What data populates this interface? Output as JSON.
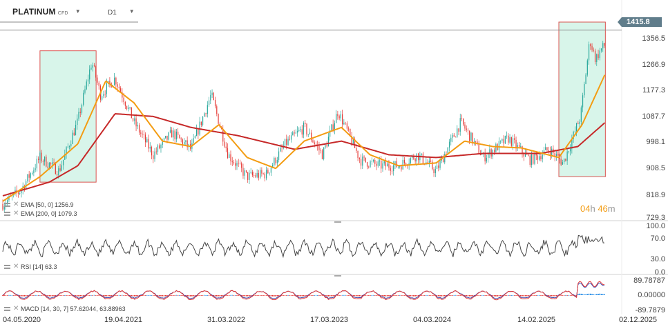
{
  "toolbar": {
    "symbol": "PLATINUM",
    "symbol_tag": "CFD",
    "interval": "D1"
  },
  "price_axis": {
    "labels": [
      "1356.5",
      "1266.9",
      "1177.3",
      "1087.7",
      "998.1",
      "908.5",
      "818.9",
      "729.3"
    ]
  },
  "current_price": "1415.8",
  "countdown": {
    "hours": "04",
    "h": "h",
    "minutes": "46",
    "m": "m"
  },
  "indicators": {
    "ema50": "EMA [50, 0] 1256.9",
    "ema200": "EMA [200, 0] 1079.3",
    "rsi": "RSI [14] 63.3",
    "macd": "MACD [14, 30, 7] 57.62044, 63.88963"
  },
  "rsi_axis": {
    "labels": [
      "100.0",
      "70.0",
      "30.0",
      "0.0"
    ]
  },
  "macd_axis": {
    "labels": [
      "89.78787",
      "0.00000",
      "-89.7879"
    ]
  },
  "dates": [
    "04.05.2020",
    "19.04.2021",
    "31.03.2022",
    "17.03.2023",
    "04.03.2024",
    "14.02.2025",
    "02.12.2025"
  ],
  "colors": {
    "up": "#26a69a",
    "down": "#e53935",
    "ema50": "#f39c12",
    "ema200": "#c62828",
    "highlight_fill": "#d8f5ea",
    "highlight_border": "#d9534f",
    "rsi": "#444444",
    "macd_line": "#e53935",
    "signal_line": "#3f51b5",
    "hist_up": "#1e88e5",
    "hist_down": "#e53935"
  },
  "chart_data": {
    "type": "candlestick",
    "x_range": [
      "2020-05-04",
      "2025-12-02"
    ],
    "y_range": [
      729.3,
      1445.0
    ],
    "price_path": [
      {
        "date": "2020-05-04",
        "value": 780
      },
      {
        "date": "2020-07-01",
        "value": 830
      },
      {
        "date": "2020-09-01",
        "value": 950
      },
      {
        "date": "2020-11-01",
        "value": 900
      },
      {
        "date": "2020-12-31",
        "value": 1080
      },
      {
        "date": "2021-02-15",
        "value": 1300
      },
      {
        "date": "2021-03-15",
        "value": 1180
      },
      {
        "date": "2021-05-01",
        "value": 1240
      },
      {
        "date": "2021-07-01",
        "value": 1080
      },
      {
        "date": "2021-09-01",
        "value": 960
      },
      {
        "date": "2021-11-01",
        "value": 1040
      },
      {
        "date": "2022-01-01",
        "value": 980
      },
      {
        "date": "2022-03-07",
        "value": 1180
      },
      {
        "date": "2022-05-01",
        "value": 960
      },
      {
        "date": "2022-07-01",
        "value": 880
      },
      {
        "date": "2022-09-01",
        "value": 890
      },
      {
        "date": "2022-11-01",
        "value": 1000
      },
      {
        "date": "2023-01-01",
        "value": 1060
      },
      {
        "date": "2023-03-01",
        "value": 960
      },
      {
        "date": "2023-04-20",
        "value": 1120
      },
      {
        "date": "2023-07-01",
        "value": 940
      },
      {
        "date": "2023-09-01",
        "value": 920
      },
      {
        "date": "2023-11-01",
        "value": 920
      },
      {
        "date": "2024-01-01",
        "value": 960
      },
      {
        "date": "2024-03-01",
        "value": 900
      },
      {
        "date": "2024-05-20",
        "value": 1080
      },
      {
        "date": "2024-08-01",
        "value": 950
      },
      {
        "date": "2024-10-20",
        "value": 1020
      },
      {
        "date": "2024-12-31",
        "value": 940
      },
      {
        "date": "2025-03-01",
        "value": 980
      },
      {
        "date": "2025-04-15",
        "value": 930
      },
      {
        "date": "2025-06-10",
        "value": 1100
      },
      {
        "date": "2025-07-10",
        "value": 1380
      },
      {
        "date": "2025-07-28",
        "value": 1310
      },
      {
        "date": "2025-08-15",
        "value": 1345
      },
      {
        "date": "2025-08-29",
        "value": 1362
      }
    ],
    "ema50_path": [
      {
        "date": "2020-05-04",
        "value": 790
      },
      {
        "date": "2020-09-01",
        "value": 880
      },
      {
        "date": "2021-01-01",
        "value": 1000
      },
      {
        "date": "2021-04-01",
        "value": 1230
      },
      {
        "date": "2021-07-01",
        "value": 1150
      },
      {
        "date": "2021-10-01",
        "value": 1010
      },
      {
        "date": "2022-01-01",
        "value": 990
      },
      {
        "date": "2022-04-01",
        "value": 1070
      },
      {
        "date": "2022-07-01",
        "value": 950
      },
      {
        "date": "2022-10-01",
        "value": 910
      },
      {
        "date": "2023-01-01",
        "value": 1010
      },
      {
        "date": "2023-05-01",
        "value": 1060
      },
      {
        "date": "2023-08-01",
        "value": 960
      },
      {
        "date": "2023-11-01",
        "value": 920
      },
      {
        "date": "2024-03-01",
        "value": 930
      },
      {
        "date": "2024-06-01",
        "value": 1010
      },
      {
        "date": "2024-09-01",
        "value": 990
      },
      {
        "date": "2024-12-01",
        "value": 985
      },
      {
        "date": "2025-04-01",
        "value": 950
      },
      {
        "date": "2025-06-15",
        "value": 1070
      },
      {
        "date": "2025-08-29",
        "value": 1257
      }
    ],
    "ema200_path": [
      {
        "date": "2020-05-04",
        "value": 810
      },
      {
        "date": "2020-10-01",
        "value": 860
      },
      {
        "date": "2021-01-01",
        "value": 920
      },
      {
        "date": "2021-05-01",
        "value": 1110
      },
      {
        "date": "2021-09-01",
        "value": 1100
      },
      {
        "date": "2022-01-01",
        "value": 1060
      },
      {
        "date": "2022-06-01",
        "value": 1030
      },
      {
        "date": "2022-12-01",
        "value": 980
      },
      {
        "date": "2023-05-01",
        "value": 1010
      },
      {
        "date": "2023-10-01",
        "value": 960
      },
      {
        "date": "2024-03-01",
        "value": 950
      },
      {
        "date": "2024-08-01",
        "value": 965
      },
      {
        "date": "2025-02-01",
        "value": 965
      },
      {
        "date": "2025-06-01",
        "value": 990
      },
      {
        "date": "2025-08-29",
        "value": 1079
      }
    ],
    "highlights": [
      {
        "start": "2020-09-01",
        "end": "2021-03-01",
        "low": 860,
        "high": 1340
      },
      {
        "start": "2025-04-01",
        "end": "2025-08-29",
        "low": 880,
        "high": 1445
      }
    ],
    "rsi": {
      "range": [
        0,
        100
      ],
      "last": 63.3,
      "levels": [
        70,
        30
      ]
    },
    "macd": {
      "range": [
        -89.7879,
        89.78787
      ],
      "macd": 57.62044,
      "signal": 63.88963
    }
  }
}
